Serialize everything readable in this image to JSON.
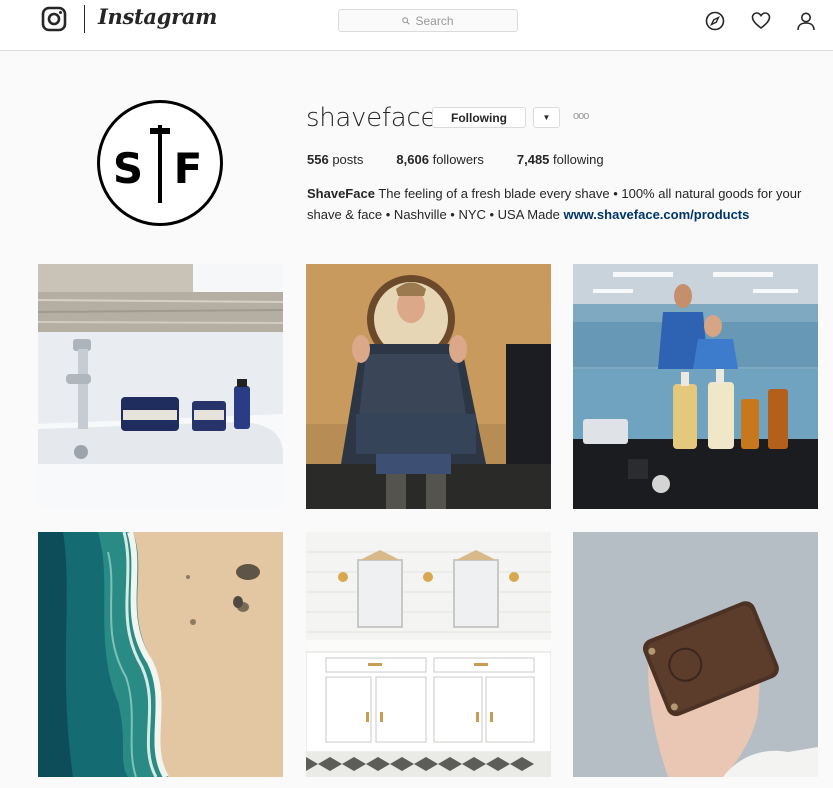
{
  "header": {
    "wordmark": "Instagram",
    "search_placeholder": "Search",
    "icons": [
      "instagram-glyph-icon",
      "compass-icon",
      "heart-icon",
      "person-icon"
    ]
  },
  "profile": {
    "username": "shaveface",
    "follow_label": "Following",
    "dropdown_label": "▼",
    "more_label": "ooo",
    "avatar_text": "S|F",
    "stats": {
      "posts_count": "556",
      "posts_label": "posts",
      "followers_count": "8,606",
      "followers_label": "followers",
      "following_count": "7,485",
      "following_label": "following"
    },
    "bio": {
      "name": "ShaveFace",
      "text": "The feeling of a fresh blade every shave • 100% all natural goods for your shave & face • Nashville • NYC • USA Made",
      "link": "www.shaveface.com/products"
    }
  },
  "posts": [
    {
      "id": "post-sink-products"
    },
    {
      "id": "post-barber-chair"
    },
    {
      "id": "post-barbershop-mirror"
    },
    {
      "id": "post-aerial-beach"
    },
    {
      "id": "post-white-bathroom"
    },
    {
      "id": "post-leather-wallet"
    }
  ],
  "colors": {
    "link": "#003569",
    "border": "#dbdbdb",
    "background": "#fafafa"
  }
}
